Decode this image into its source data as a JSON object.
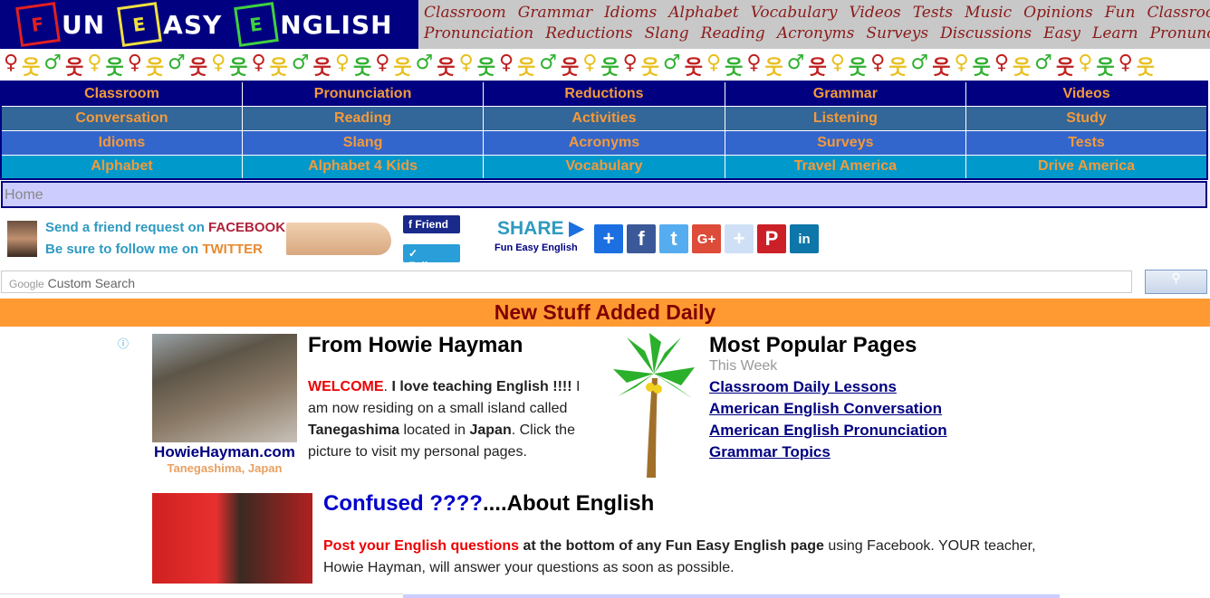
{
  "logo": {
    "words": [
      "UN",
      "ASY",
      "NGLISH"
    ],
    "letters": [
      "F",
      "E",
      "E"
    ],
    "colors": [
      "#e02020",
      "#f0e040",
      "#40d040"
    ]
  },
  "banner_links": {
    "row1": [
      "Classroom",
      "Grammar",
      "Idioms",
      "Alphabet",
      "Vocabulary",
      "Videos",
      "Tests",
      "Music",
      "Opinions",
      "Fun",
      "Classroom"
    ],
    "row2": [
      "Pronunciation",
      "Reductions",
      "Slang",
      "Reading",
      "Acronyms",
      "Surveys",
      "Discussions",
      "Easy",
      "Learn",
      "Pronunc"
    ]
  },
  "nav": {
    "rows": [
      {
        "color": "#000080",
        "items": [
          "Classroom",
          "Pronunciation",
          "Reductions",
          "Grammar",
          "Videos"
        ]
      },
      {
        "color": "#336699",
        "items": [
          "Conversation",
          "Reading",
          "Activities",
          "Listening",
          "Study"
        ]
      },
      {
        "color": "#3366cc",
        "items": [
          "Idioms",
          "Slang",
          "Acronyms",
          "Surveys",
          "Tests"
        ]
      },
      {
        "color": "#0099cc",
        "items": [
          "Alphabet",
          "Alphabet 4 Kids",
          "Vocabulary",
          "Travel America",
          "Drive America"
        ]
      }
    ]
  },
  "breadcrumb": "Home",
  "social": {
    "line1": "Send a friend request on ",
    "facebook": "FACEBOOK",
    "line2": "Be sure to follow me on ",
    "twitter": "TWITTER",
    "friend_btn": "Friend",
    "follow_btn": "Follow",
    "share": "SHARE",
    "share_sub": "Fun Easy English",
    "share_buttons": [
      {
        "icon": "plus-icon",
        "glyph": "+",
        "color": "#1b6fe0"
      },
      {
        "icon": "facebook-icon",
        "glyph": "f",
        "color": "#3b5998"
      },
      {
        "icon": "twitter-icon",
        "glyph": "t",
        "color": "#55acee"
      },
      {
        "icon": "google-plus-icon",
        "glyph": "G+",
        "color": "#dd4b39"
      },
      {
        "icon": "plus-light-icon",
        "glyph": "+",
        "color": "#cfe0f6"
      },
      {
        "icon": "pinterest-icon",
        "glyph": "P",
        "color": "#cb2027"
      },
      {
        "icon": "linkedin-icon",
        "glyph": "in",
        "color": "#0e76a8"
      }
    ]
  },
  "search": {
    "brand": "Google",
    "placeholder": "Custom Search"
  },
  "banner_bar": "New Stuff Added Daily",
  "howie": {
    "title": "From Howie Hayman",
    "site": "HowieHayman.com",
    "location": "Tanegashima, Japan",
    "welcome": "WELCOME",
    "welcome_rest": ". ",
    "love": "I love teaching English !!!!",
    "t1": "I am now residing on a small island called ",
    "island": "Tanegashima",
    "t2": " located in ",
    "country": "Japan",
    "t3": ". Click the picture to visit my personal pages."
  },
  "popular": {
    "title": "Most Popular Pages",
    "subtitle": "This Week",
    "links": [
      "Classroom Daily Lessons",
      "American English Conversation",
      "American English Pronunciation",
      "Grammar Topics"
    ]
  },
  "confused": {
    "title_blue": "Confused ????",
    "title_black": "....About English",
    "red": "Post your English questions",
    "bold": " at the bottom of any Fun Easy English page",
    "rest": " using Facebook. YOUR teacher, Howie Hayman, will answer your questions as soon as possible."
  }
}
